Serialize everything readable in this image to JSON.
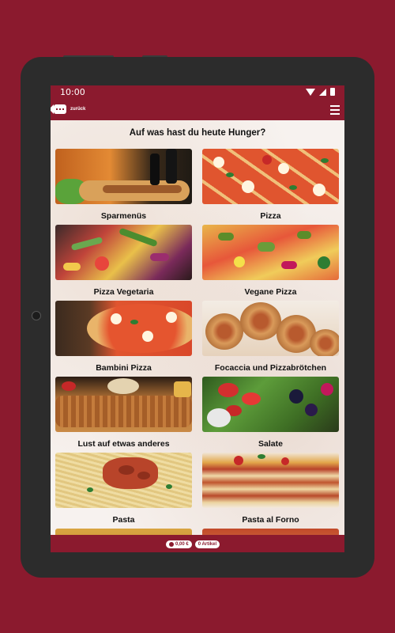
{
  "status": {
    "time": "10:00"
  },
  "appbar": {
    "back_label": "zurück"
  },
  "page": {
    "headline": "Auf was hast du heute Hunger?"
  },
  "categories": [
    {
      "label": "Sparmenüs"
    },
    {
      "label": "Pizza"
    },
    {
      "label": "Pizza Vegetaria"
    },
    {
      "label": "Vegane Pizza"
    },
    {
      "label": "Bambini Pizza"
    },
    {
      "label": "Focaccia und Pizzabrötchen"
    },
    {
      "label": "Lust auf etwas anderes"
    },
    {
      "label": "Salate"
    },
    {
      "label": "Pasta"
    },
    {
      "label": "Pasta al Forno"
    }
  ],
  "cart": {
    "total": "0,00 €",
    "items": "0 Artikel"
  },
  "colors": {
    "brand": "#8b1a2e",
    "background": "#f7f2ef"
  },
  "icons": {
    "back": "back-arrow-icon",
    "menu": "hamburger-menu-icon",
    "cart": "cart-icon",
    "wifi": "wifi-icon",
    "signal": "signal-icon",
    "battery": "battery-icon"
  }
}
